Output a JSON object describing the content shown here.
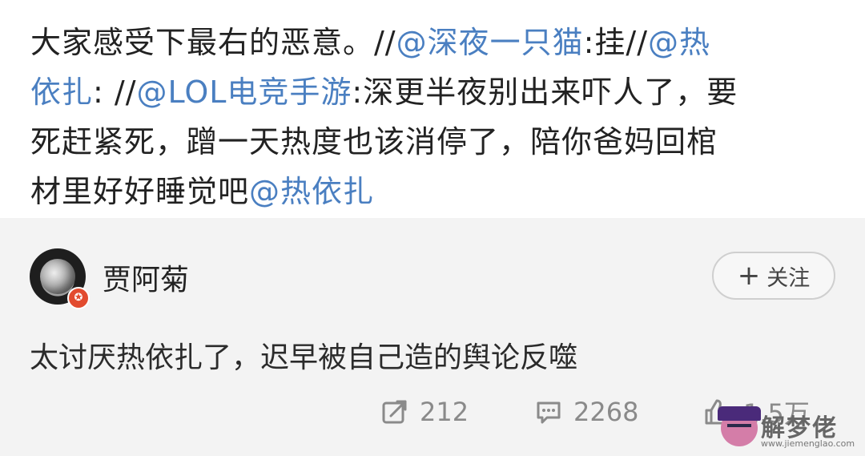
{
  "post": {
    "line1_text": "大家感受下最右的恶意。//",
    "line1_mention": "@深夜一只猫",
    "line1_mid": ":挂//",
    "line1_mention2": "@热",
    "line2_mention": "依扎",
    "line2_mid": ": //",
    "line2_mention2": "@LOL电竞手游",
    "line2_text": ":深更半夜别出来吓人了，要",
    "line3_text": "死赶紧死，蹭一天热度也该消停了，陪你爸妈回棺",
    "line4_text": "材里好好睡觉吧",
    "line4_mention": "@热依扎"
  },
  "comment": {
    "username": "贾阿菊",
    "follow_label": "关注",
    "follow_plus": "+",
    "text": "太讨厌热依扎了，迟早被自己造的舆论反噬"
  },
  "actions": {
    "repost_count": "212",
    "comment_count": "2268",
    "like_count": "1.5万"
  },
  "watermark": {
    "title": "解梦佬",
    "url": "www.jiemenglao.com"
  },
  "colors": {
    "mention": "#4a7fc1",
    "card_bg": "#f3f3f3",
    "badge": "#e24b2f"
  }
}
